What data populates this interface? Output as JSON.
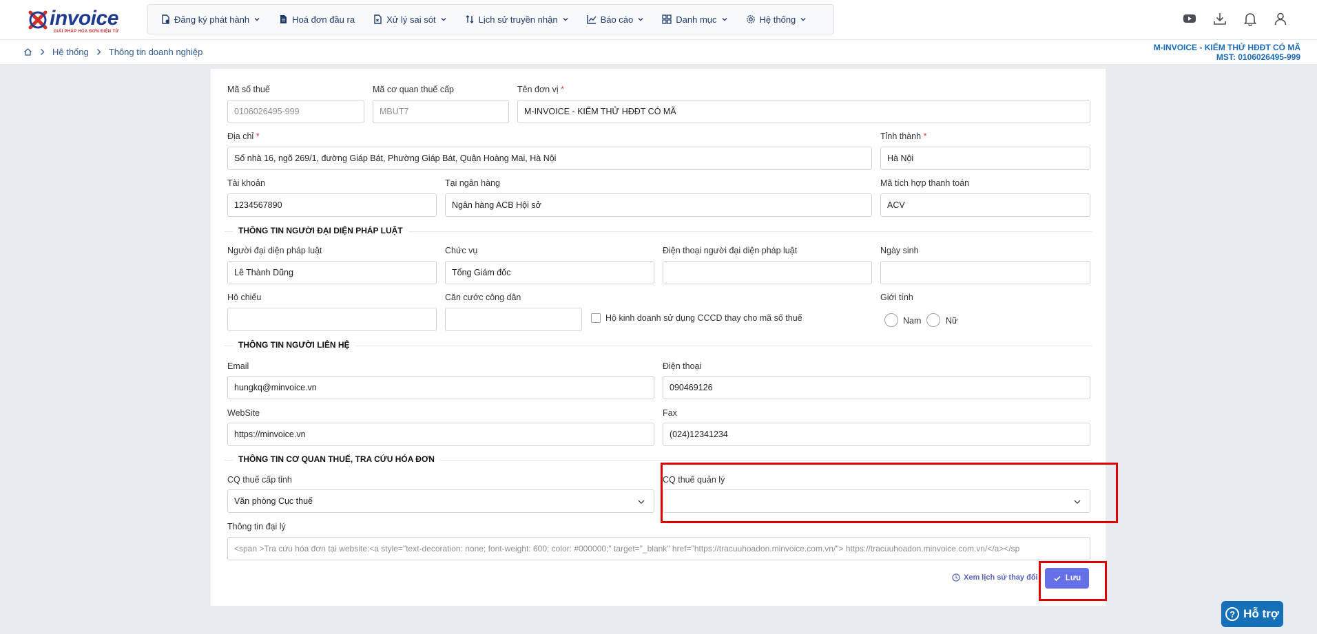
{
  "logo": {
    "text": "invoice",
    "tagline": "GIẢI PHÁP HÓA ĐƠN ĐIỆN TỬ"
  },
  "menu": [
    {
      "label": "Đăng ký phát hành",
      "icon": "file-register-icon",
      "dropdown": true
    },
    {
      "label": "Hoá đơn đầu ra",
      "icon": "invoice-file-icon",
      "dropdown": false
    },
    {
      "label": "Xử lý sai sót",
      "icon": "error-file-icon",
      "dropdown": true
    },
    {
      "label": "Lịch sử truyền nhận",
      "icon": "transfer-arrows-icon",
      "dropdown": true
    },
    {
      "label": "Báo cáo",
      "icon": "chart-icon",
      "dropdown": true
    },
    {
      "label": "Danh mục",
      "icon": "grid-icon",
      "dropdown": true
    },
    {
      "label": "Hệ thống",
      "icon": "gear-icon",
      "dropdown": true
    }
  ],
  "top_icons": [
    "youtube-icon",
    "download-icon",
    "bell-icon",
    "user-icon"
  ],
  "breadcrumb": {
    "level1": "Hệ thống",
    "level2": "Thông tin doanh nghiệp"
  },
  "company": {
    "name": "M-INVOICE - KIỂM THỬ HĐĐT CÓ MÃ",
    "mst": "MST: 0106026495-999"
  },
  "form": {
    "tax_code": {
      "label": "Mã số thuế",
      "value": "0106026495-999"
    },
    "tax_authority_code": {
      "label": "Mã cơ quan thuế cấp",
      "value": "MBUT7"
    },
    "unit_name": {
      "label": "Tên đơn vị",
      "value": "M-INVOICE - KIỂM THỬ HĐĐT CÓ MÃ"
    },
    "address": {
      "label": "Địa chỉ",
      "value": "Số nhà 16, ngõ 269/1, đường Giáp Bát, Phường Giáp Bát, Quận Hoàng Mai, Hà Nội"
    },
    "province": {
      "label": "Tỉnh thành",
      "value": "Hà Nội"
    },
    "account": {
      "label": "Tài khoản",
      "value": "1234567890"
    },
    "bank": {
      "label": "Tại ngân hàng",
      "value": "Ngân hàng ACB Hội sở"
    },
    "payment_code": {
      "label": "Mã tích hợp thanh toán",
      "value": "ACV"
    },
    "legal_section": "THÔNG TIN NGƯỜI ĐẠI DIỆN PHÁP LUẬT",
    "legal_rep": {
      "label": "Người đại diện pháp luật",
      "value": "Lê Thành Dũng"
    },
    "position": {
      "label": "Chức vụ",
      "value": "Tổng Giám đốc"
    },
    "rep_phone": {
      "label": "Điện thoại người đại diện pháp luật",
      "value": ""
    },
    "birthday": {
      "label": "Ngày sinh",
      "value": ""
    },
    "passport": {
      "label": "Hộ chiếu",
      "value": ""
    },
    "citizen_id": {
      "label": "Căn cước công dân",
      "value": ""
    },
    "cccd_checkbox": {
      "label": "Hộ kinh doanh sử dụng CCCD thay cho mã số thuế",
      "checked": false
    },
    "gender": {
      "label": "Giới tính",
      "male": "Nam",
      "female": "Nữ",
      "selected": ""
    },
    "contact_section": "THÔNG TIN NGƯỜI LIÊN HỆ",
    "email": {
      "label": "Email",
      "value": "hungkq@minvoice.vn"
    },
    "phone": {
      "label": "Điện thoại",
      "value": "090469126"
    },
    "website": {
      "label": "WebSite",
      "value": "https://minvoice.vn"
    },
    "fax": {
      "label": "Fax",
      "value": "(024)12341234"
    },
    "tax_section": "THÔNG TIN CƠ QUAN THUẾ, TRA CỨU HÓA ĐƠN",
    "province_tax": {
      "label": "CQ thuế cấp tỉnh",
      "value": "Văn phòng Cục thuế"
    },
    "managing_tax": {
      "label": "CQ thuế quản lý",
      "value": ""
    },
    "agent_info": {
      "label": "Thông tin đại lý",
      "value": "<span >Tra cứu hóa đơn tại website:<a style=\"text-decoration: none; font-weight: 600; color: #000000;\" target=\"_blank\" href=\"https://tracuuhoadon.minvoice.com.vn/\"> https://tracuuhoadon.minvoice.com.vn/</a></sp"
    }
  },
  "actions": {
    "history": "Xem lịch sử thay đổi",
    "save": "Lưu"
  },
  "support": "Hỗ trợ",
  "colors": {
    "brand": "#1f3a93",
    "accent": "#6670e6",
    "highlight": "#e00000",
    "support": "#1670b8"
  }
}
